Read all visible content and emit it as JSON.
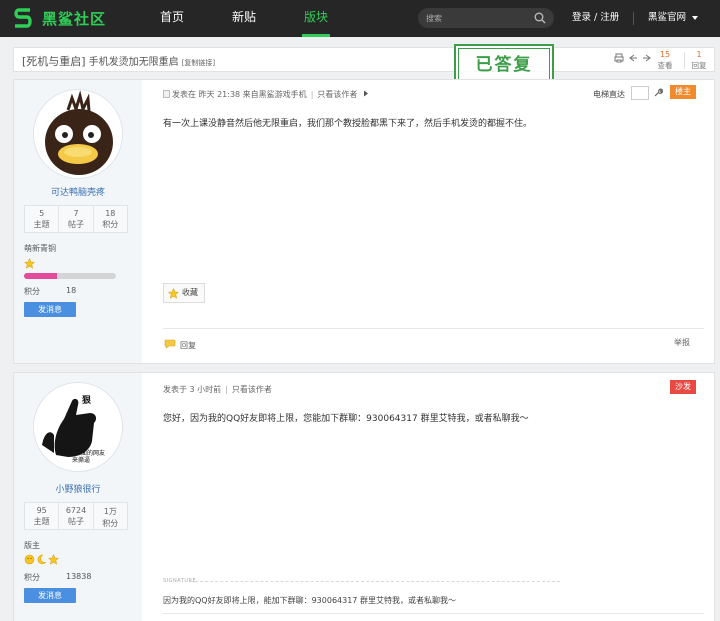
{
  "nav": {
    "logo_text": "黑鲨社区",
    "items": [
      "首页",
      "新贴",
      "版块"
    ],
    "search_placeholder": "搜索",
    "login_label": "登录 / 注册",
    "official_label": "黑鲨官网"
  },
  "thread": {
    "category": "[死机与重启]",
    "title": "手机发烫加无限重启",
    "copy_link": "[复制链接]",
    "stamp": "已答复",
    "views": "15",
    "views_label": "查看",
    "replies": "1",
    "replies_label": "回复"
  },
  "posts": [
    {
      "username": "可达鸭脑壳疼",
      "stats": [
        {
          "value": "5",
          "label": "主题"
        },
        {
          "value": "7",
          "label": "帖子"
        },
        {
          "value": "18",
          "label": "积分"
        }
      ],
      "rank": "萌新青铜",
      "exp_fraction": 0.36,
      "credit_label": "积分",
      "credit_value": "18",
      "pm_label": "发消息",
      "posted": "发表在",
      "time": "昨天 21:38 来自黑鲨游戏手机",
      "view_author": "只看该作者",
      "eyes_care": "电梯直达",
      "tag": "楼主",
      "tag_color": "#f08a2c",
      "content": "有一次上课没静音然后他无限重启，我们那个教授脸都黑下来了，然后手机发烫的都握不住。",
      "favorite_label": "收藏",
      "reply_label": "回复",
      "report_label": "举报"
    },
    {
      "username": "小野狼很行",
      "avatar_text_top": "狠",
      "avatar_text_bottom": "气不愿意面的网友\n来撕逼",
      "stats": [
        {
          "value": "95",
          "label": "主题"
        },
        {
          "value": "6724",
          "label": "帖子"
        },
        {
          "value": "1万",
          "label": "积分"
        }
      ],
      "rank": "版主",
      "credit_label": "积分",
      "credit_value": "13838",
      "pm_label": "发消息",
      "posted": "发表于",
      "time": "3 小时前",
      "view_author": "只看该作者",
      "tag": "沙发",
      "tag_color": "#e84a43",
      "content": "您好，因为我的QQ好友即将上限，您能加下群聊：930064317 群里艾特我，或者私聊我～",
      "sig_label": "SIGNATURE",
      "signature": "因为我的QQ好友即将上限，能加下群聊：930064317 群里艾特我，或者私聊我～"
    }
  ]
}
